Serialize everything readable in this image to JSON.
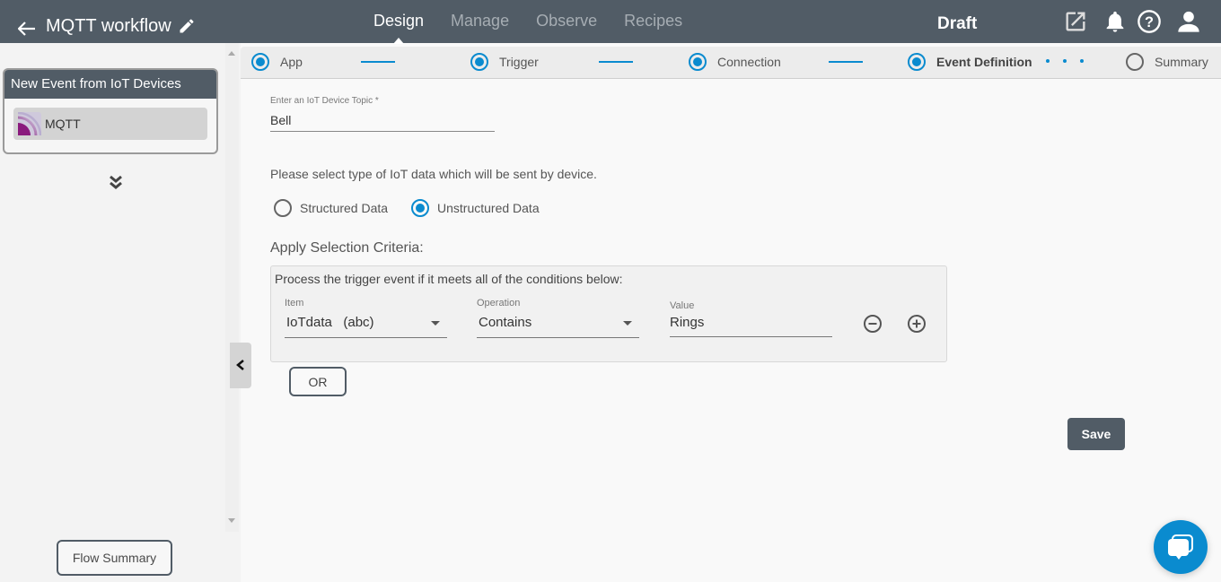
{
  "header": {
    "back_icon": "arrow-left",
    "title": "MQTT workflow",
    "edit_icon": "pencil",
    "nav": [
      {
        "label": "Design",
        "active": true
      },
      {
        "label": "Manage",
        "active": false
      },
      {
        "label": "Observe",
        "active": false
      },
      {
        "label": "Recipes",
        "active": false
      }
    ],
    "status": "Draft",
    "icons": [
      "external-link",
      "bell",
      "help-circle",
      "user"
    ]
  },
  "sidebar": {
    "card_title": "New Event from IoT Devices",
    "card_item": {
      "label": "MQTT",
      "icon": "mqtt-logo"
    },
    "expand_icon": "chevron-double-down",
    "collapse_icon": "chevron-left",
    "flow_summary_label": "Flow Summary"
  },
  "stepper": {
    "steps": [
      {
        "label": "App",
        "state": "done"
      },
      {
        "label": "Trigger",
        "state": "done"
      },
      {
        "label": "Connection",
        "state": "done"
      },
      {
        "label": "Event Definition",
        "state": "current"
      },
      {
        "label": "Summary",
        "state": "pending"
      }
    ]
  },
  "form": {
    "topic_label": "Enter an IoT Device Topic *",
    "topic_value": "Bell",
    "data_type_prompt": "Please select type of IoT data which will be sent by device.",
    "data_types": [
      {
        "label": "Structured Data",
        "selected": false
      },
      {
        "label": "Unstructured Data",
        "selected": true
      }
    ],
    "criteria_title": "Apply Selection Criteria:",
    "criteria": {
      "description": "Process the trigger event if it meets all of the conditions below:",
      "item_label": "Item",
      "item_value": "IoTdata   (abc)",
      "operation_label": "Operation",
      "operation_value": "Contains",
      "value_label": "Value",
      "value_value": "Rings",
      "remove_icon": "minus-circle",
      "add_icon": "plus-circle"
    },
    "or_label": "OR",
    "save_label": "Save"
  },
  "chat": {
    "icon": "chat-bubbles"
  },
  "colors": {
    "header_bg": "#515c66",
    "accent": "#0a8bcf",
    "sidebar_bg": "#f3f3f3"
  }
}
